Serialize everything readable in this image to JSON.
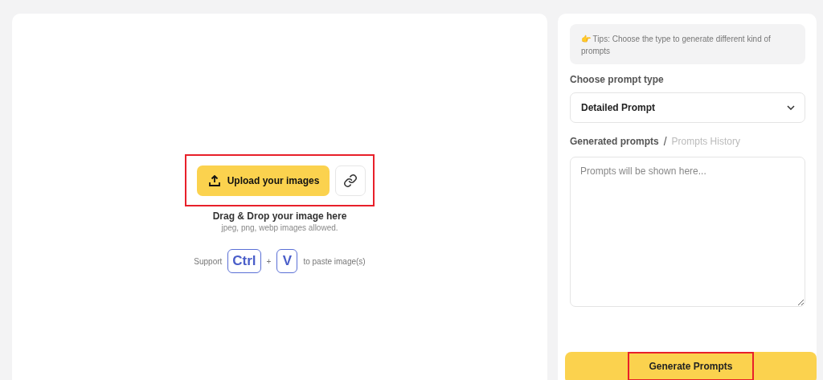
{
  "upload": {
    "button": "Upload your images",
    "title": "Drag & Drop your image here",
    "subtitle": "jpeg, png, webp images allowed.",
    "highlighted": true
  },
  "paste": {
    "prefix": "Support",
    "keys": [
      "Ctrl",
      "V"
    ],
    "plus": "+",
    "suffix": "to paste image(s)"
  },
  "tips": {
    "emoji": "👉",
    "text": "Tips: Choose the type to generate different kind of prompts"
  },
  "prompt_type": {
    "label": "Choose prompt type",
    "value": "Detailed Prompt"
  },
  "tabs": [
    {
      "label": "Generated prompts",
      "selected": true
    },
    {
      "label": "Prompts History",
      "selected": false
    }
  ],
  "tab_separator": "/",
  "output": {
    "placeholder": "Prompts will be shown here..."
  },
  "generate": {
    "label": "Generate Prompts",
    "highlighted": true
  }
}
